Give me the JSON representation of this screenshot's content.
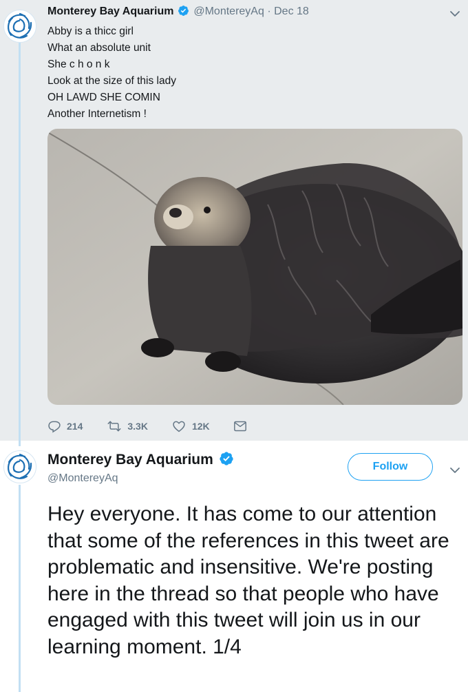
{
  "tweet1": {
    "display_name": "Monterey Bay Aquarium",
    "handle": "@MontereyAq",
    "separator": "·",
    "date": "Dec 18",
    "lines": [
      "Abby is a thicc girl",
      "What an absolute unit",
      "She c h o n k",
      "Look at the size of this lady",
      "OH LAWD SHE COMIN",
      "Another Internetism !"
    ],
    "image_alt": "sea otter photo",
    "replies": "214",
    "retweets": "3.3K",
    "likes": "12K"
  },
  "tweet2": {
    "display_name": "Monterey Bay Aquarium",
    "handle": "@MontereyAq",
    "follow_label": "Follow",
    "body": "Hey everyone. It has come to our attention that some of the references in this tweet are problematic and insensitive. We're posting here in the thread so that people who have engaged with this tweet will join us in our learning moment. 1/4"
  },
  "colors": {
    "accent": "#1da1f2",
    "thread_line": "#c2dff3",
    "muted": "#657786",
    "tweet1_bg": "#e9ecee"
  },
  "icons": [
    "verified-badge-icon",
    "chevron-down-icon",
    "reply-icon",
    "retweet-icon",
    "like-icon",
    "dm-icon"
  ]
}
